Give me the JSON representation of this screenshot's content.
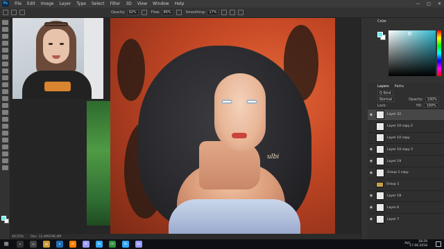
{
  "menubar": {
    "logo": "Ps",
    "items": [
      "File",
      "Edit",
      "Image",
      "Layer",
      "Type",
      "Select",
      "Filter",
      "3D",
      "View",
      "Window",
      "Help"
    ],
    "window_controls": [
      "—",
      "□",
      "✕"
    ]
  },
  "options": {
    "opacity_label": "Opacity:",
    "opacity_value": "92%",
    "flow_label": "Flow:",
    "flow_value": "86%",
    "smoothing_label": "Smoothing:",
    "smoothing_value": "17%"
  },
  "color_panel": {
    "title": "Color",
    "fg_color": "#6ee7f5",
    "bg_color": "#ffffff"
  },
  "layers_panel": {
    "tabs": [
      "Layers",
      "Paths"
    ],
    "kind_label": "Q Kind",
    "blend_mode": "Normal",
    "opacity_label": "Opacity:",
    "opacity_value": "100%",
    "lock_label": "Lock:",
    "fill_label": "Fill:",
    "fill_value": "100%",
    "layers": [
      {
        "name": "Layer 22",
        "visible": true,
        "active": true
      },
      {
        "name": "Layer 10 copy 2",
        "visible": false
      },
      {
        "name": "Layer 10 copy",
        "visible": false
      },
      {
        "name": "Layer 10 copy 3",
        "visible": true
      },
      {
        "name": "Layer 19",
        "visible": true
      },
      {
        "name": "Group 1 copy",
        "visible": true
      },
      {
        "name": "Group 1",
        "visible": false,
        "group": true
      },
      {
        "name": "Layer 18",
        "visible": true
      },
      {
        "name": "Layer 6",
        "visible": true
      },
      {
        "name": "Layer 7",
        "visible": true
      }
    ]
  },
  "statusbar": {
    "zoom": "40,55%",
    "doc": "Doc: 12,4M/196,4M"
  },
  "painting": {
    "signature": "ulbi"
  },
  "taskbar": {
    "apps": [
      {
        "label": "e",
        "color": "#1f6fb2"
      },
      {
        "label": "Ai",
        "color": "#ff7c00"
      },
      {
        "label": "Pr",
        "color": "#9999ff"
      },
      {
        "label": "Ps",
        "color": "#31a8ff"
      },
      {
        "label": "Ch",
        "color": "#2d8f3e"
      },
      {
        "label": "Ps",
        "color": "#31a8ff"
      },
      {
        "label": "Ae",
        "color": "#9999ff"
      }
    ],
    "lang": "РУС",
    "time": "18:29",
    "date": "17.06.2018"
  }
}
